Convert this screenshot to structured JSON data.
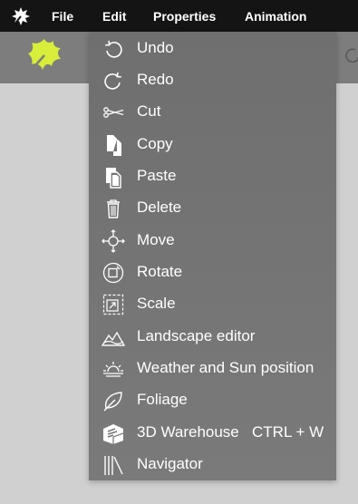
{
  "menubar": {
    "logo_icon": "app-leaf-icon",
    "items": [
      {
        "label": "File"
      },
      {
        "label": "Edit"
      },
      {
        "label": "Properties"
      },
      {
        "label": "Animation"
      }
    ]
  },
  "toolbar": {
    "logo_icon": "yellow-leaf-icon",
    "accent_color": "#d8ee3a"
  },
  "edit_menu": {
    "items": [
      {
        "label": "Undo",
        "icon": "undo-icon",
        "shortcut": ""
      },
      {
        "label": "Redo",
        "icon": "redo-icon",
        "shortcut": ""
      },
      {
        "label": "Cut",
        "icon": "scissors-icon",
        "shortcut": ""
      },
      {
        "label": "Copy",
        "icon": "copy-icon",
        "shortcut": ""
      },
      {
        "label": "Paste",
        "icon": "paste-icon",
        "shortcut": ""
      },
      {
        "label": "Delete",
        "icon": "trash-icon",
        "shortcut": ""
      },
      {
        "label": "Move",
        "icon": "move-icon",
        "shortcut": ""
      },
      {
        "label": "Rotate",
        "icon": "rotate-icon",
        "shortcut": ""
      },
      {
        "label": "Scale",
        "icon": "scale-icon",
        "shortcut": ""
      },
      {
        "label": "Landscape editor",
        "icon": "landscape-icon",
        "shortcut": ""
      },
      {
        "label": "Weather and Sun position",
        "icon": "sunrise-icon",
        "shortcut": ""
      },
      {
        "label": "Foliage",
        "icon": "leaf-icon",
        "shortcut": ""
      },
      {
        "label": "3D Warehouse",
        "icon": "warehouse-icon",
        "shortcut": "CTRL + W"
      },
      {
        "label": "Navigator",
        "icon": "navigator-icon",
        "shortcut": ""
      }
    ]
  }
}
